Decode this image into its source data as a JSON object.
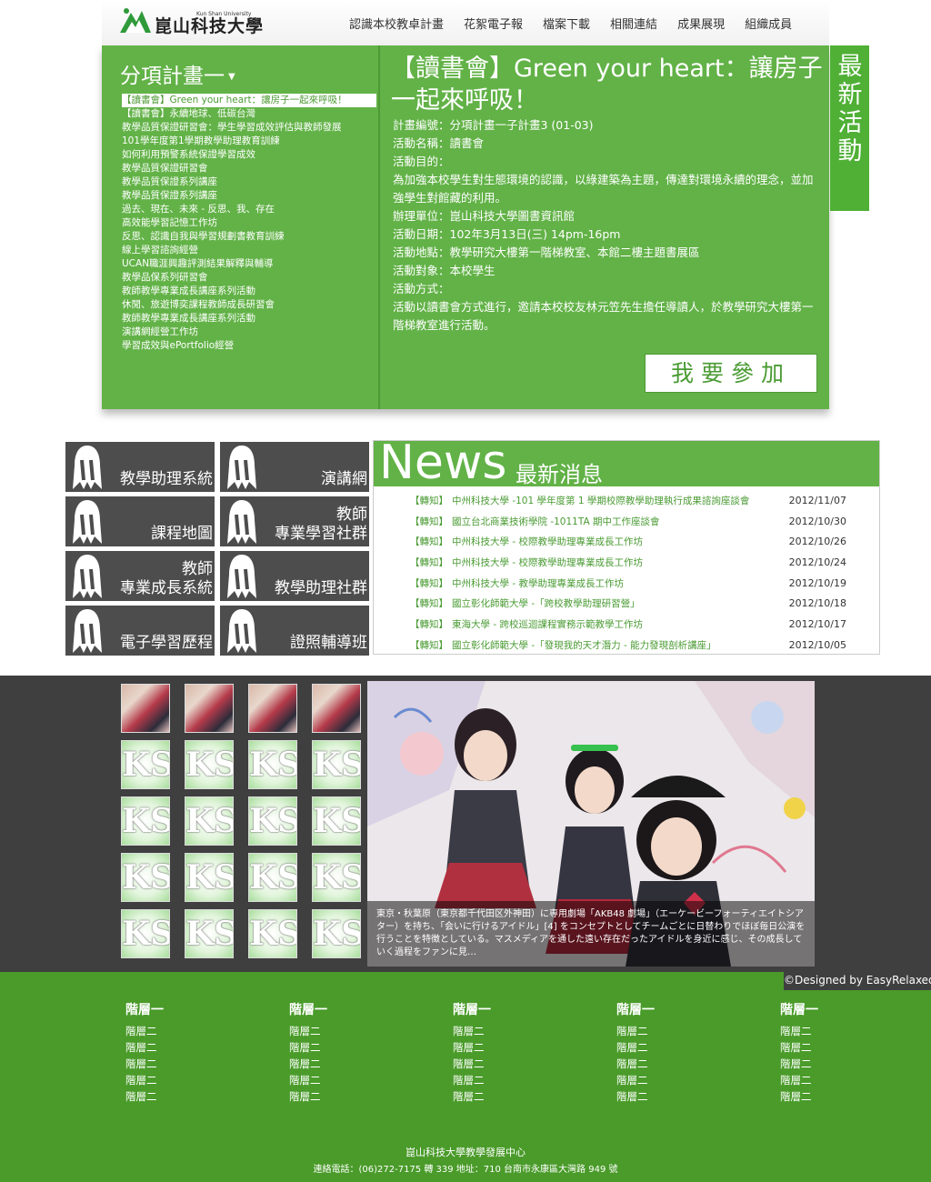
{
  "header": {
    "logo_en": "Kun Shan University",
    "logo_zh": "崑山科技大學",
    "nav": [
      "認識本校教卓計畫",
      "花絮電子報",
      "檔案下載",
      "相關連結",
      "成果展現",
      "組織成員"
    ]
  },
  "projects": {
    "title": "分項計畫一",
    "items": [
      "【讀書會】Green your heart：讓房子一起來呼吸！",
      "【讀書會】永續地球、低碳台灣",
      "教學品質保證研習會：學生學習成效評估與教師發展",
      "101學年度第1學期教學助理教育訓練",
      "如何利用預警系統保證學習成效",
      "教學品質保證研習會",
      "教學品質保證系列講座",
      "教學品質保證系列講座",
      "過去、現在、未來 - 反思、我、存在",
      "高效能學習記憶工作坊",
      "反思、認識自我與學習規劃書教育訓練",
      "線上學習諮詢經營",
      "UCAN職涯興趣評測結果解釋與輔導",
      "教學品保系列研習會",
      "教師教學專業成長講座系列活動",
      "休閒、旅遊博奕課程教師成長研習會",
      "教師教學專業成長講座系列活動",
      "演講網經營工作坊",
      "學習成效與ePortfolio經營"
    ]
  },
  "activity": {
    "title": "【讀書會】Green your heart：讓房子一起來呼吸！",
    "details": [
      "計畫編號：分項計畫一子計畫3 (01-03)",
      "活動名稱：讀書會",
      "活動目的：",
      "為加強本校學生對生態環境的認識，以綠建築為主題，傳達對環境永續的理念，並加強學生對館藏的利用。",
      "辦理單位：崑山科技大學圖書資訊館",
      "活動日期：102年3月13日(三) 14pm-16pm",
      "活動地點：教學研究大樓第一階梯教室、本館二樓主題書展區",
      "活動對象：本校學生",
      "活動方式：",
      "活動以讀書會方式進行，邀請本校校友林元笠先生擔任導讀人，於教學研究大樓第一階梯教室進行活動。"
    ],
    "join_label": "我要參加"
  },
  "latest_tab": "最新活動",
  "systems": [
    "教學助理系統",
    "演講網",
    "課程地圖",
    "教師\n專業學習社群",
    "教師\n專業成長系統",
    "教學助理社群",
    "電子學習歷程",
    "證照輔導班"
  ],
  "news": {
    "title_en": "News",
    "title_zh": "最新消息",
    "items": [
      {
        "tag": "【轉知】",
        "title": "中州科技大學 -101 學年度第 1 學期校際教學助理執行成果諮詢座談會",
        "date": "2012/11/07"
      },
      {
        "tag": "【轉知】",
        "title": "國立台北商業技術學院 -1011TA 期中工作座談會",
        "date": "2012/10/30"
      },
      {
        "tag": "【轉知】",
        "title": "中州科技大學 - 校際教學助理專業成長工作坊",
        "date": "2012/10/26"
      },
      {
        "tag": "【轉知】",
        "title": "中州科技大學 - 校際教學助理專業成長工作坊",
        "date": "2012/10/24"
      },
      {
        "tag": "【轉知】",
        "title": "中州科技大學 - 教學助理專業成長工作坊",
        "date": "2012/10/19"
      },
      {
        "tag": "【轉知】",
        "title": "國立彰化師範大學 -「跨校教學助理研習營」",
        "date": "2012/10/18"
      },
      {
        "tag": "【轉知】",
        "title": "東海大學 - 跨校巡迴課程實務示範教學工作坊",
        "date": "2012/10/17"
      },
      {
        "tag": "【轉知】",
        "title": "國立彰化師範大學 -「發現我的天才潛力 - 能力發現剖析講座」",
        "date": "2012/10/05"
      }
    ]
  },
  "gallery": {
    "caption": "東京・秋葉原（東京都千代田区外神田）に専用劇場「AKB48 劇場」（エーケービーフォーティエイトシアター）を持ち、「会いに行けるアイドル」[4] をコンセプトとしてチームごとに日替わりでほぼ毎日公演を行うことを特徴としている。マスメディアを通した遠い存在だったアイドルを身近に感じ、その成長していく過程をファンに見…",
    "placeholder_glyph": "KSU",
    "credit": "©Designed by EasyRelaxed"
  },
  "footer": {
    "columns": [
      {
        "heading": "階層一",
        "items": [
          "階層二",
          "階層二",
          "階層二",
          "階層二",
          "階層二"
        ]
      },
      {
        "heading": "階層一",
        "items": [
          "階層二",
          "階層二",
          "階層二",
          "階層二",
          "階層二"
        ]
      },
      {
        "heading": "階層一",
        "items": [
          "階層二",
          "階層二",
          "階層二",
          "階層二",
          "階層二"
        ]
      },
      {
        "heading": "階層一",
        "items": [
          "階層二",
          "階層二",
          "階層二",
          "階層二",
          "階層二"
        ]
      },
      {
        "heading": "階層一",
        "items": [
          "階層二",
          "階層二",
          "階層二",
          "階層二",
          "階層二"
        ]
      }
    ],
    "org": "崑山科技大學教學發展中心",
    "contact": "連絡電話：(06)272-7175 轉 339 地址：710 台南市永康區大灣路 949 號"
  },
  "colors": {
    "brand_green": "#62b247",
    "dark_green": "#4a9b2a",
    "tile_gray": "#4d4d4d",
    "gallery_bg": "#3f3f3f"
  }
}
